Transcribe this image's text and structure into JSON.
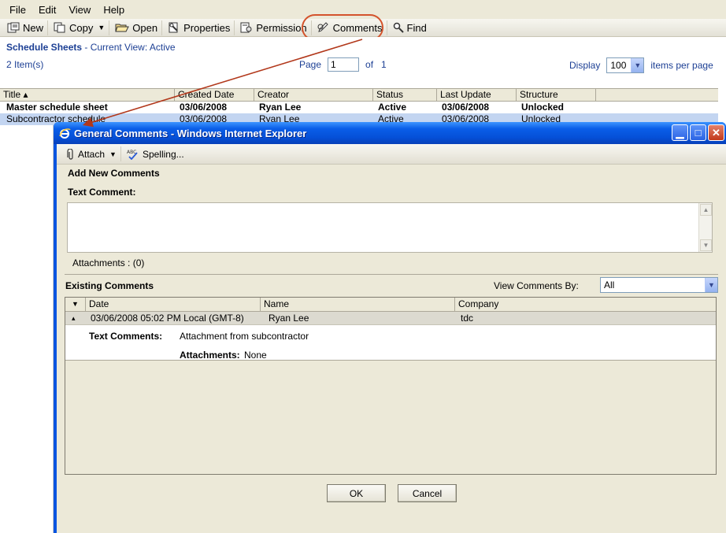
{
  "menu": [
    "File",
    "Edit",
    "View",
    "Help"
  ],
  "toolbar": {
    "new": "New",
    "copy": "Copy",
    "open": "Open",
    "properties": "Properties",
    "permission": "Permission",
    "comments": "Comments",
    "find": "Find"
  },
  "header": {
    "section": "Schedule Sheets",
    "view_label": " - Current View:  Active",
    "items": "2  Item(s)",
    "page_label": "Page",
    "page_value": "1",
    "of_label": "of",
    "page_total": "1",
    "display_label": "Display",
    "per_page": "100",
    "per_page_label": "items per page"
  },
  "grid": {
    "columns": [
      "Title ▴",
      "Created Date",
      "Creator",
      "Status",
      "Last Update",
      "Structure"
    ],
    "rows": [
      [
        "Master schedule sheet",
        "03/06/2008",
        "Ryan Lee",
        "Active",
        "03/06/2008",
        "Unlocked"
      ],
      [
        "Subcontractor schedule",
        "03/06/2008",
        "Ryan Lee",
        "Active",
        "03/06/2008",
        "Unlocked"
      ]
    ]
  },
  "popup": {
    "title": "General Comments - Windows Internet Explorer",
    "attach": "Attach",
    "spelling": "Spelling...",
    "add_new": "Add New Comments",
    "text_comment": "Text Comment:",
    "attachments": "Attachments : (0)",
    "existing": "Existing Comments",
    "view_by_label": "View Comments By:",
    "view_by_value": "All",
    "columns": [
      "▼",
      "Date",
      "Name",
      "Company"
    ],
    "comment": {
      "toggle": "▴",
      "date": "03/06/2008 05:02 PM Local (GMT-8)",
      "name": "Ryan  Lee",
      "company": "tdc",
      "text_label": "Text Comments:",
      "text_value": "Attachment from subcontractor",
      "att_label": "Attachments:",
      "att_value": "None"
    },
    "ok": "OK",
    "cancel": "Cancel"
  },
  "colors": {
    "accent_link": "#1c3f94",
    "annotation": "#d4532c",
    "titlebar": "#0a55e0",
    "selected_row": "#c3d5f1"
  }
}
